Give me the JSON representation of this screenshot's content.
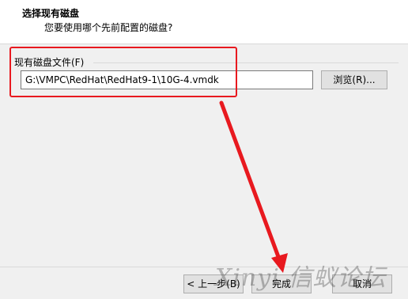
{
  "header": {
    "title": "选择现有磁盘",
    "subtitle": "您要使用哪个先前配置的磁盘?"
  },
  "disk_group": {
    "label": "现有磁盘文件(F)",
    "path_value": "G:\\VMPC\\RedHat\\RedHat9-1\\10G-4.vmdk",
    "browse_label": "浏览(R)..."
  },
  "footer": {
    "back_label": "< 上一步(B)",
    "finish_label": "完成",
    "cancel_label": "取消"
  },
  "watermark": {
    "text": "Xinyi 信蚁论坛"
  },
  "colors": {
    "highlight": "#e8191f",
    "header_bg": "#ffffff",
    "dialog_bg": "#f0f0f0"
  }
}
